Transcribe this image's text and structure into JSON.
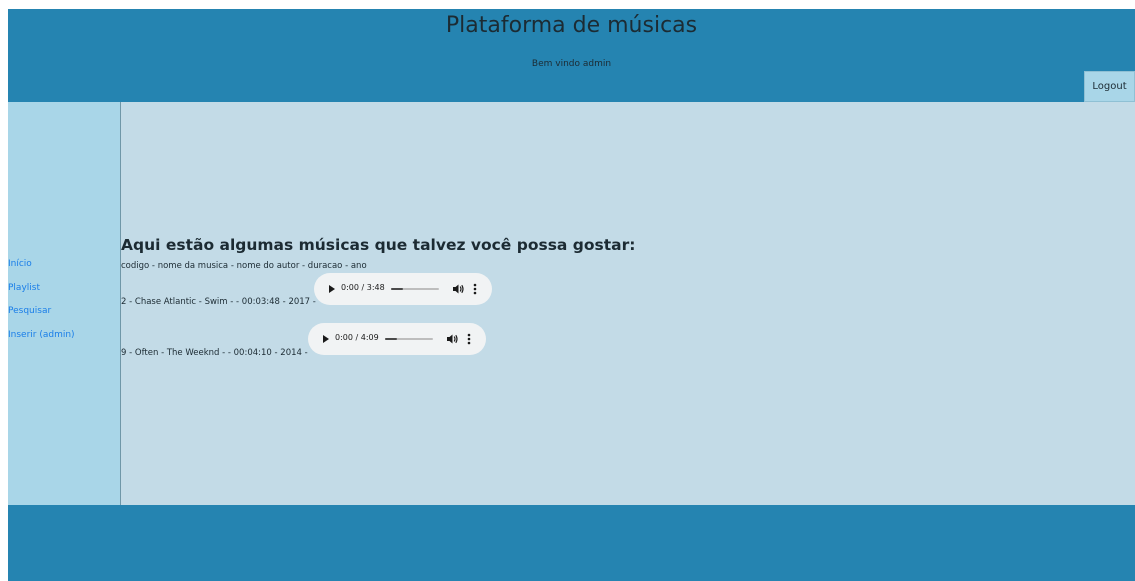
{
  "header": {
    "title": "Plataforma de músicas",
    "welcome": "Bem vindo admin",
    "logout_label": "Logout"
  },
  "sidebar": {
    "items": [
      {
        "label": "Início"
      },
      {
        "label": "Playlist"
      },
      {
        "label": "Pesquisar"
      },
      {
        "label": "Inserir (admin)"
      }
    ]
  },
  "main": {
    "title": "Aqui estão algumas músicas que talvez você possa gostar:",
    "columns": "codigo - nome da musica - nome do autor - duracao - ano",
    "songs": [
      {
        "text": "2 - Chase Atlantic - Swim - - 00:03:48 - 2017 -",
        "player_time": "0:00 / 3:48",
        "progress": 0.25
      },
      {
        "text": "9 - Often - The Weeknd - - 00:04:10 - 2014 -",
        "player_time": "0:00 / 4:09",
        "progress": 0.25
      }
    ]
  },
  "colors": {
    "header_bg": "#2584b1",
    "sidebar_bg": "#a9d6e8",
    "main_bg": "#c3dbe7",
    "link": "#1a7ee8"
  }
}
